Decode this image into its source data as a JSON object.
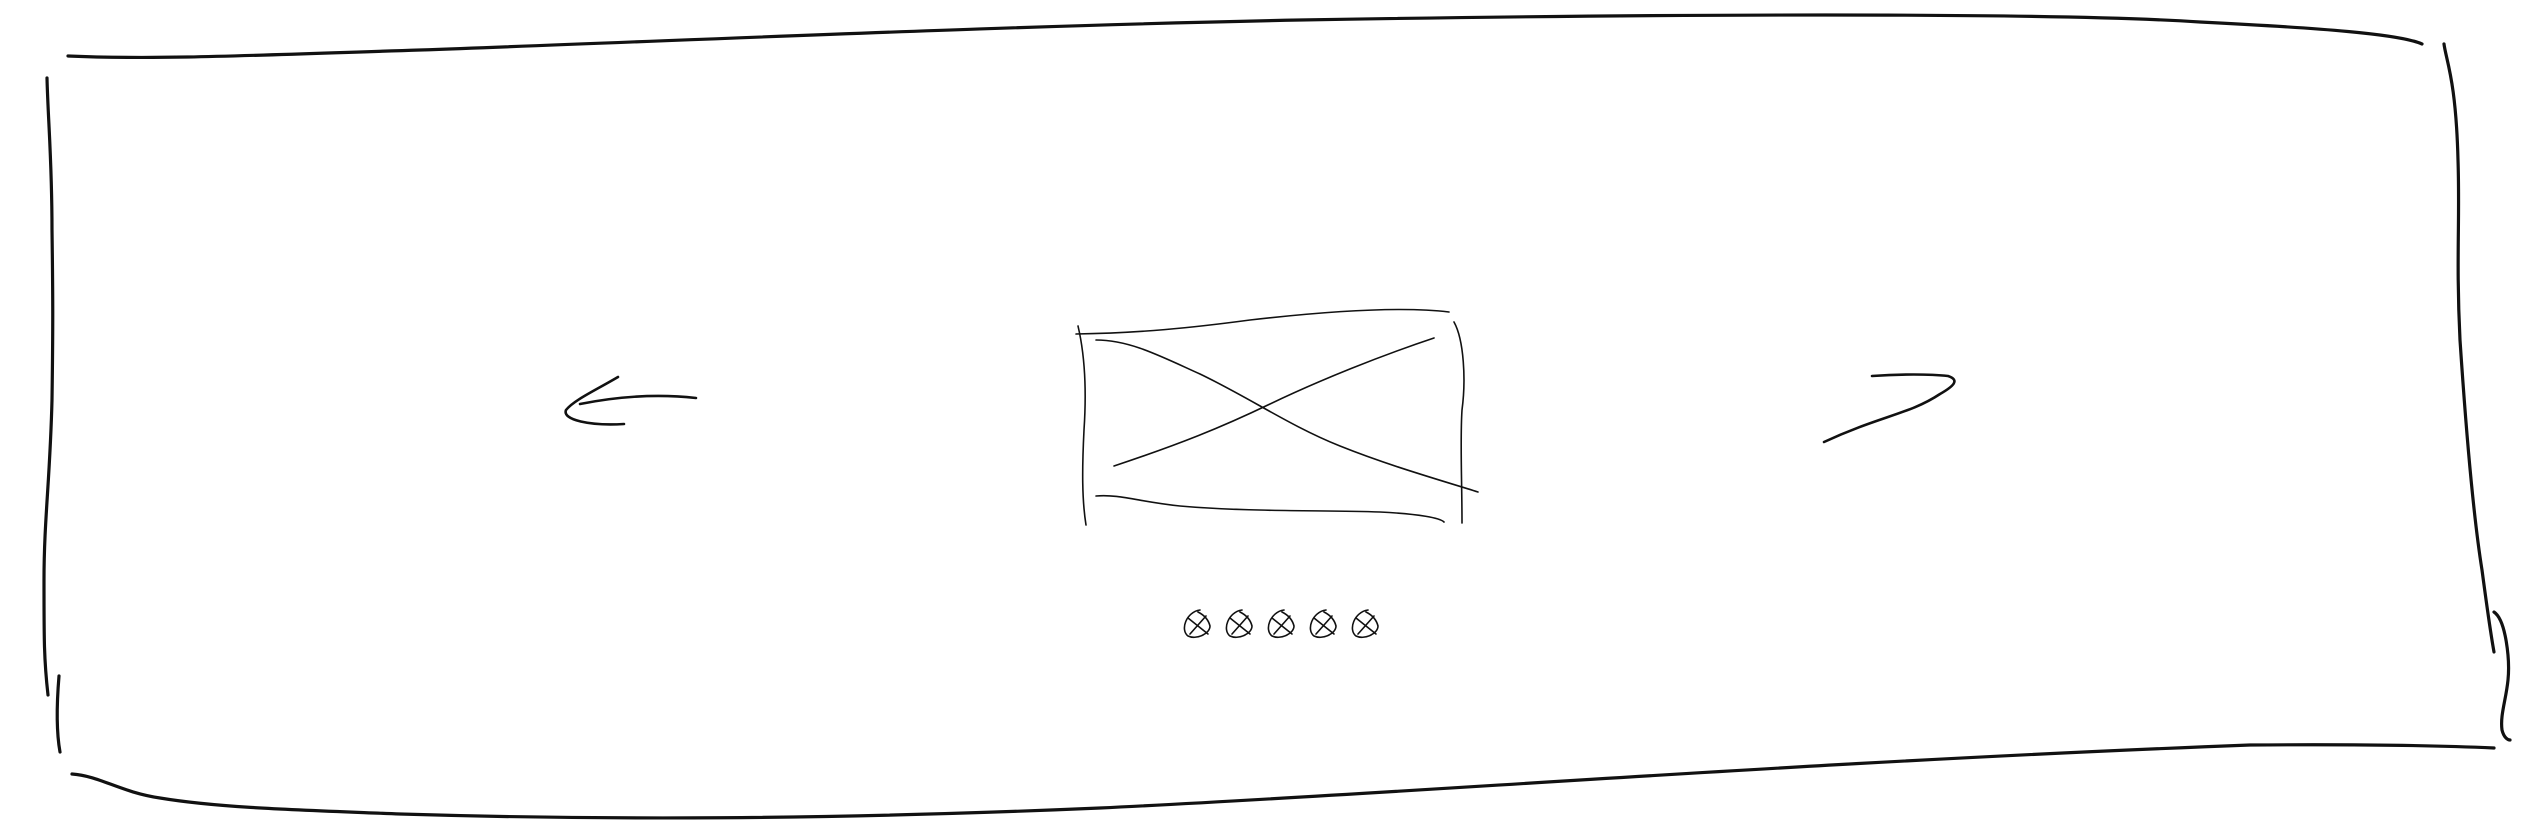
{
  "carousel": {
    "frame_color": "#111111",
    "background": "#ffffff",
    "prev": {
      "icon": "arrow-left-icon"
    },
    "next": {
      "icon": "arrow-right-icon"
    },
    "slide": {
      "icon": "image-placeholder-icon"
    },
    "pagination": {
      "count": 5,
      "dot_icon": "crossed-circle-icon"
    }
  }
}
